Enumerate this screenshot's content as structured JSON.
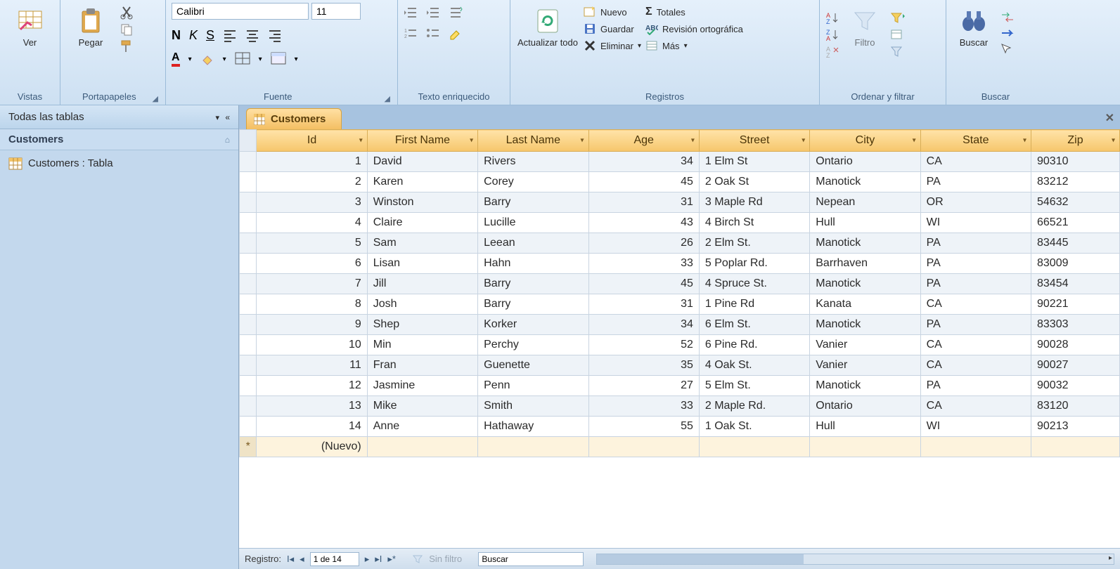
{
  "ribbon": {
    "groups": {
      "vistas": {
        "label": "Vistas",
        "ver": "Ver"
      },
      "porta": {
        "label": "Portapapeles",
        "pegar": "Pegar"
      },
      "fuente": {
        "label": "Fuente",
        "font": "Calibri",
        "size": "11"
      },
      "texto": {
        "label": "Texto enriquecido"
      },
      "registros": {
        "label": "Registros",
        "actualizar": "Actualizar todo",
        "nuevo": "Nuevo",
        "guardar": "Guardar",
        "eliminar": "Eliminar",
        "totales": "Totales",
        "revision": "Revisión ortográfica",
        "mas": "Más"
      },
      "orden": {
        "label": "Ordenar y filtrar",
        "filtro": "Filtro"
      },
      "buscar": {
        "label": "Buscar",
        "buscar": "Buscar"
      }
    }
  },
  "nav": {
    "title": "Todas las tablas",
    "group": "Customers",
    "item": "Customers : Tabla"
  },
  "tab": {
    "label": "Customers"
  },
  "table": {
    "columns": [
      "Id",
      "First Name",
      "Last Name",
      "Age",
      "Street",
      "City",
      "State",
      "Zip"
    ],
    "rows": [
      {
        "id": 1,
        "fn": "David",
        "ln": "Rivers",
        "age": 34,
        "st": "1 Elm St",
        "city": "Ontario",
        "state": "CA",
        "zip": "90310"
      },
      {
        "id": 2,
        "fn": "Karen",
        "ln": "Corey",
        "age": 45,
        "st": "2 Oak St",
        "city": "Manotick",
        "state": "PA",
        "zip": "83212"
      },
      {
        "id": 3,
        "fn": "Winston",
        "ln": "Barry",
        "age": 31,
        "st": "3 Maple Rd",
        "city": "Nepean",
        "state": "OR",
        "zip": "54632"
      },
      {
        "id": 4,
        "fn": "Claire",
        "ln": "Lucille",
        "age": 43,
        "st": "4 Birch St",
        "city": "Hull",
        "state": "WI",
        "zip": "66521"
      },
      {
        "id": 5,
        "fn": "Sam",
        "ln": "Leean",
        "age": 26,
        "st": "2 Elm St.",
        "city": "Manotick",
        "state": "PA",
        "zip": "83445"
      },
      {
        "id": 6,
        "fn": "Lisan",
        "ln": "Hahn",
        "age": 33,
        "st": "5 Poplar Rd.",
        "city": "Barrhaven",
        "state": "PA",
        "zip": "83009"
      },
      {
        "id": 7,
        "fn": "Jill",
        "ln": "Barry",
        "age": 45,
        "st": "4  Spruce St.",
        "city": "Manotick",
        "state": "PA",
        "zip": "83454"
      },
      {
        "id": 8,
        "fn": "Josh",
        "ln": "Barry",
        "age": 31,
        "st": "1 Pine Rd",
        "city": "Kanata",
        "state": "CA",
        "zip": "90221"
      },
      {
        "id": 9,
        "fn": "Shep",
        "ln": "Korker",
        "age": 34,
        "st": "6 Elm St.",
        "city": "Manotick",
        "state": "PA",
        "zip": "83303"
      },
      {
        "id": 10,
        "fn": "Min",
        "ln": "Perchy",
        "age": 52,
        "st": "6 Pine Rd.",
        "city": "Vanier",
        "state": "CA",
        "zip": "90028"
      },
      {
        "id": 11,
        "fn": "Fran",
        "ln": "Guenette",
        "age": 35,
        "st": "4 Oak St.",
        "city": "Vanier",
        "state": "CA",
        "zip": "90027"
      },
      {
        "id": 12,
        "fn": "Jasmine",
        "ln": "Penn",
        "age": 27,
        "st": "5 Elm St.",
        "city": "Manotick",
        "state": "PA",
        "zip": "90032"
      },
      {
        "id": 13,
        "fn": "Mike",
        "ln": "Smith",
        "age": 33,
        "st": "2 Maple Rd.",
        "city": "Ontario",
        "state": "CA",
        "zip": "83120"
      },
      {
        "id": 14,
        "fn": "Anne",
        "ln": "Hathaway",
        "age": 55,
        "st": "1 Oak St.",
        "city": "Hull",
        "state": "WI",
        "zip": "90213"
      }
    ],
    "newrow": "(Nuevo)"
  },
  "recnav": {
    "label": "Registro:",
    "pos": "1 de 14",
    "filter": "Sin filtro",
    "search": "Buscar"
  }
}
